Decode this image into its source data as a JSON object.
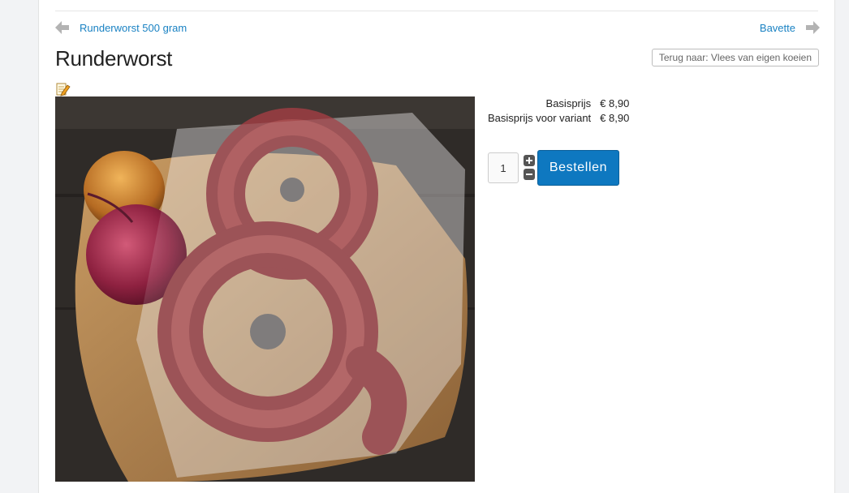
{
  "navigation": {
    "previous_label": "Runderworst 500 gram",
    "next_label": "Bavette"
  },
  "product": {
    "title": "Runderworst",
    "back_label": "Terug naar: Vlees van eigen koeien",
    "image_alt": "Runderworst"
  },
  "prices": [
    {
      "label": "Basisprijs",
      "value": "€ 8,90"
    },
    {
      "label": "Basisprijs voor variant",
      "value": "€ 8,90"
    }
  ],
  "order": {
    "quantity": "1",
    "button_label": "Bestellen"
  },
  "icons": {
    "previous": "arrow-left-icon",
    "next": "arrow-right-icon",
    "edit": "edit-pencil-icon",
    "increment": "plus-icon",
    "decrement": "minus-icon"
  },
  "colors": {
    "link": "#1a82c3",
    "primary_button": "#0e78c0",
    "page_background": "#f2f3f5"
  }
}
